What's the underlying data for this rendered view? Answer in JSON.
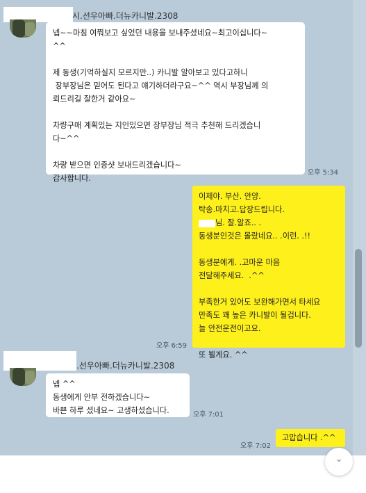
{
  "messages": [
    {
      "sender": "시.선우아빠.더뉴카니발.2308",
      "text": "넵~~마침 여쭤보고 싶었던 내용을 보내주셨네요~최고이십니다~\n^^\n\n제 동생(기억하실지 모르지만..) 카니발 알아보고 있다고하니\n 장부장님은 믿어도 된다고 얘기하더라구요~^^ 역시 부장님께 의\n뢰드리길 잘한거 같아요~\n\n차량구매 계획있는 지인있으면 장부장님 적극 추천해 드리겠습니\n다~^^\n\n차량 받으면 인증샷 보내드리겠습니다~\n감사합니다.",
      "time": "오후 5:34"
    },
    {
      "text_before_redact": "이제야. 부산. 안양.\n탁송.마치고.답장드립니다.\n",
      "text_after_redact": "님. 잘.알죠.. .\n동생분인것은 몰랐네요.. .이런. .!!\n\n동생분에게. .고마운 마음\n전달해주세요.  .^^\n\n부족한거 있어도 보완해가면서 타세요\n만족도 꽤 높은 카니발이 될겁니다.\n늘 안전운전이고요.\n\n또 뵐게요. ^^",
      "time": "오후 6:59"
    },
    {
      "sender": ".선우아빠.더뉴카니발.2308",
      "text": "넵 ^^\n동생에게 안부 전하겠습니다~\n바쁜 하루 셨네요~ 고생하셨습니다.",
      "time": "오후 7:01"
    },
    {
      "text": "고맙습니다 .^^",
      "time": "오후 7:02"
    }
  ],
  "colors": {
    "chat_background": "#b9cad9",
    "incoming_bubble": "#ffffff",
    "outgoing_bubble": "#fef01b"
  },
  "icons": {
    "fab": "chevron-down-icon"
  }
}
